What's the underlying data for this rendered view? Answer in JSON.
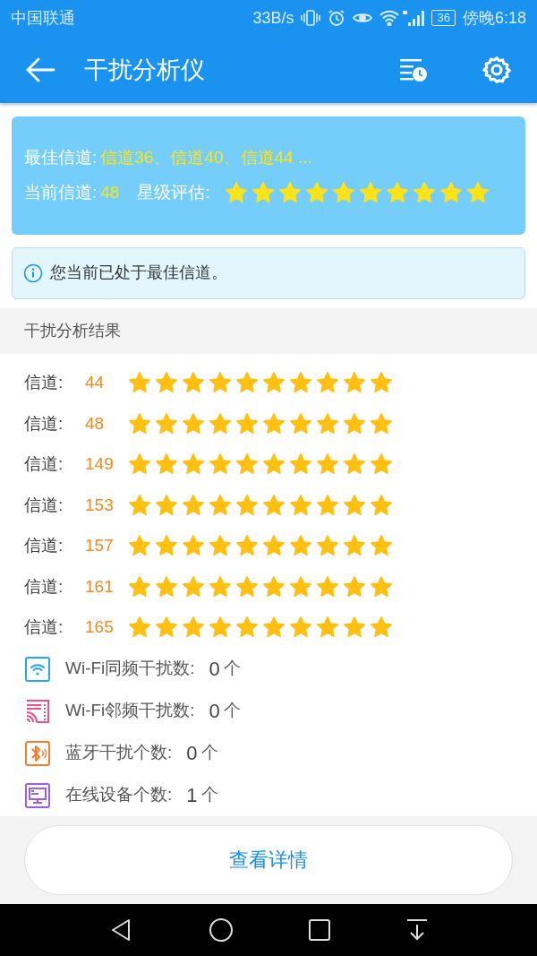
{
  "status_bar": {
    "carrier": "中国联通",
    "speed": "33B/s",
    "battery": "36",
    "time": "傍晚6:18"
  },
  "app_bar": {
    "title": "干扰分析仪"
  },
  "summary": {
    "best_label": "最佳信道:",
    "best_value": "信道36、信道40、信道44 ...",
    "current_label": "当前信道:",
    "current_value": "48",
    "rating_label": "星级评估:",
    "stars": 10
  },
  "notice": {
    "text": "您当前已处于最佳信道。"
  },
  "section_title": "干扰分析结果",
  "channels": [
    {
      "label": "信道:",
      "number": "44",
      "stars": 10
    },
    {
      "label": "信道:",
      "number": "48",
      "stars": 10
    },
    {
      "label": "信道:",
      "number": "149",
      "stars": 10
    },
    {
      "label": "信道:",
      "number": "153",
      "stars": 10
    },
    {
      "label": "信道:",
      "number": "157",
      "stars": 10
    },
    {
      "label": "信道:",
      "number": "161",
      "stars": 10
    },
    {
      "label": "信道:",
      "number": "165",
      "stars": 10
    }
  ],
  "stats": [
    {
      "kind": "wifi",
      "color": "#2aa6f0",
      "label": "Wi-Fi同频干扰数:",
      "count": "0",
      "unit": "个"
    },
    {
      "kind": "adjacent",
      "color": "#f0508a",
      "label": "Wi-Fi邻频干扰数:",
      "count": "0",
      "unit": "个"
    },
    {
      "kind": "bluetooth",
      "color": "#f57d2c",
      "label": "蓝牙干扰个数:",
      "count": "0",
      "unit": "个"
    },
    {
      "kind": "device",
      "color": "#9b5de5",
      "label": "在线设备个数:",
      "count": "1",
      "unit": "个"
    }
  ],
  "details_button": "查看详情"
}
